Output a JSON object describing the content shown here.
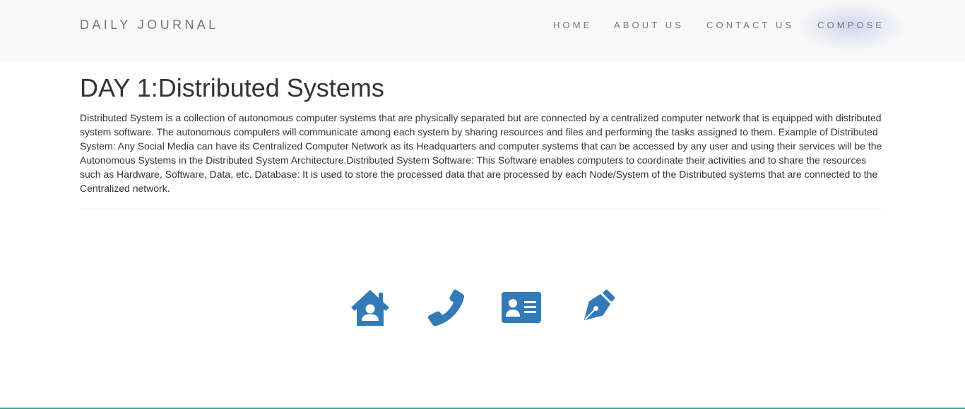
{
  "navbar": {
    "brand": "DAILY JOURNAL",
    "links": [
      {
        "label": "HOME"
      },
      {
        "label": "ABOUT US"
      },
      {
        "label": "CONTACT US"
      },
      {
        "label": "COMPOSE"
      }
    ]
  },
  "post": {
    "title": "DAY 1:Distributed Systems",
    "body": "Distributed System is a collection of autonomous computer systems that are physically separated but are connected by a centralized computer network that is equipped with distributed system software. The autonomous computers will communicate among each system by sharing resources and files and performing the tasks assigned to them. Example of Distributed System: Any Social Media can have its Centralized Computer Network as its Headquarters and computer systems that can be accessed by any user and using their services will be the Autonomous Systems in the Distributed System Architecture.Distributed System Software: This Software enables computers to coordinate their activities and to share the resources such as Hardware, Software, Data, etc. Database: It is used to store the processed data that are processed by each Node/System of the Distributed systems that are connected to the Centralized network."
  },
  "footer": {
    "icons": [
      "house-user-icon",
      "phone-icon",
      "address-card-icon",
      "pen-nib-icon"
    ],
    "icon_color": "#337ab7"
  },
  "colors": {
    "navbar_bg": "#f8f8f8",
    "nav_text": "#777777",
    "body_text": "#333333",
    "accent_line": "#3aa59a"
  }
}
